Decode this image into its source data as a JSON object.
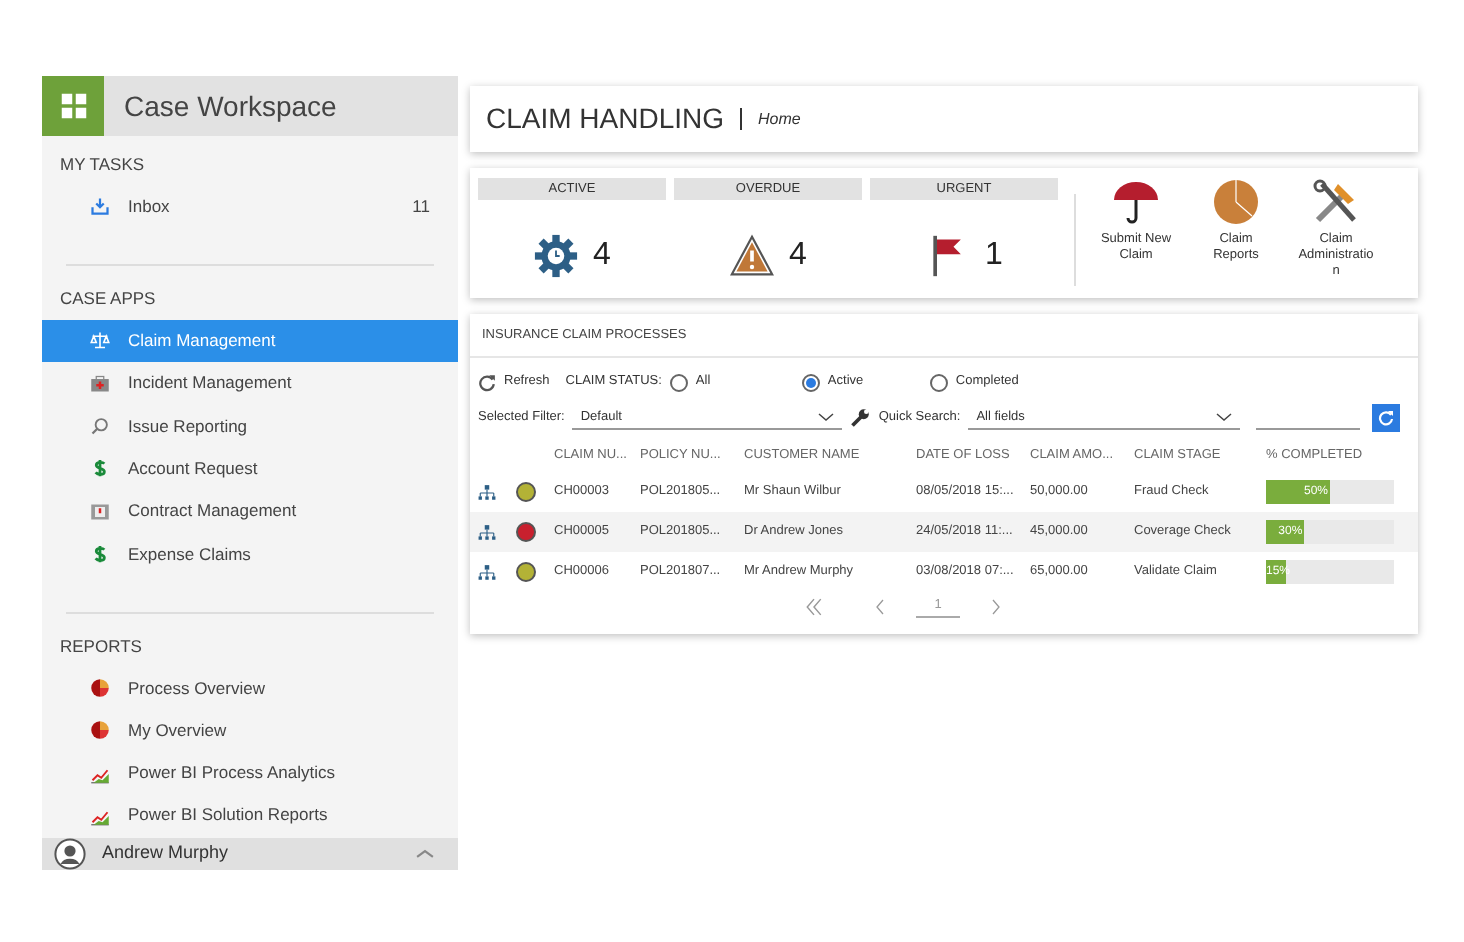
{
  "sidebar": {
    "title": "Case Workspace",
    "sections": [
      {
        "heading": "MY TASKS",
        "items": [
          {
            "label": "Inbox",
            "count": "11",
            "kind": "inbox",
            "selected": false
          }
        ]
      },
      {
        "heading": "CASE APPS",
        "items": [
          {
            "label": "Claim Management",
            "kind": "scales",
            "selected": true
          },
          {
            "label": "Incident Management",
            "kind": "medkit",
            "selected": false
          },
          {
            "label": "Issue Reporting",
            "kind": "search",
            "selected": false
          },
          {
            "label": "Account Request",
            "kind": "dollar",
            "selected": false
          },
          {
            "label": "Contract Management",
            "kind": "contract",
            "selected": false
          },
          {
            "label": "Expense Claims",
            "kind": "dollar",
            "selected": false
          }
        ]
      },
      {
        "heading": "REPORTS",
        "items": [
          {
            "label": "Process Overview",
            "kind": "pie",
            "selected": false
          },
          {
            "label": "My Overview",
            "kind": "pie",
            "selected": false
          },
          {
            "label": "Power BI Process Analytics",
            "kind": "chart",
            "selected": false
          },
          {
            "label": "Power BI Solution Reports",
            "kind": "chart",
            "selected": false
          }
        ]
      }
    ],
    "user": {
      "name": "Andrew Murphy"
    }
  },
  "page": {
    "title": "CLAIM HANDLING",
    "breadcrumb": "Home"
  },
  "stats": [
    {
      "label": "ACTIVE",
      "value": "4",
      "kind": "gear"
    },
    {
      "label": "OVERDUE",
      "value": "4",
      "kind": "warning"
    },
    {
      "label": "URGENT",
      "value": "1",
      "kind": "flag"
    }
  ],
  "actions": [
    {
      "label": "Submit New Claim",
      "kind": "umbrella"
    },
    {
      "label": "Claim Reports",
      "kind": "pie"
    },
    {
      "label": "Claim Administration",
      "kind": "tools"
    }
  ],
  "processes": {
    "title": "INSURANCE CLAIM PROCESSES",
    "refresh": "Refresh",
    "status_label": "CLAIM STATUS:",
    "status_options": [
      {
        "label": "All",
        "selected": false
      },
      {
        "label": "Active",
        "selected": true
      },
      {
        "label": "Completed",
        "selected": false
      }
    ],
    "filter": {
      "label": "Selected Filter:",
      "value": "Default"
    },
    "quick_search": {
      "label": "Quick Search:",
      "value": "All fields"
    },
    "columns": [
      "CLAIM NU...",
      "POLICY NU...",
      "CUSTOMER NAME",
      "DATE OF LOSS",
      "CLAIM AMO...",
      "CLAIM STAGE",
      "% COMPLETED"
    ],
    "rows": [
      {
        "color": "#b3b236",
        "cells": [
          "CH00003",
          "POL201805...",
          "Mr Shaun Wilbur",
          "08/05/2018 15:...",
          "50,000.00",
          "Fraud Check"
        ],
        "progress": "50%",
        "level": 0.5
      },
      {
        "color": "#c8202e",
        "cells": [
          "CH00005",
          "POL201805...",
          "Dr Andrew Jones",
          "24/05/2018 11:...",
          "45,000.00",
          "Coverage Check"
        ],
        "progress": "30%",
        "level": 0.3
      },
      {
        "color": "#b3b236",
        "cells": [
          "CH00006",
          "POL201807...",
          "Mr Andrew Murphy",
          "03/08/2018 07:...",
          "65,000.00",
          "Validate Claim"
        ],
        "progress": "15%",
        "level": 0.15
      }
    ],
    "page": "1"
  }
}
